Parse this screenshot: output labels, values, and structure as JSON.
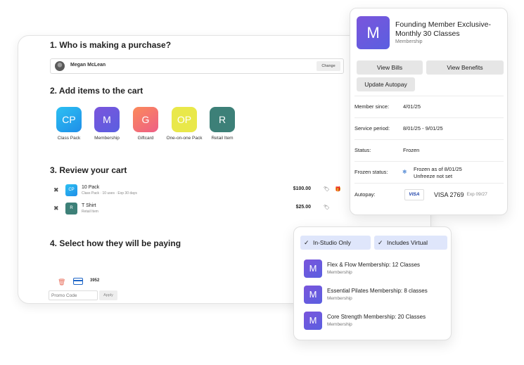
{
  "purchase": {
    "step1_title": "1. Who is making a purchase?",
    "buyer_name": "Megan McLean",
    "change_label": "Change",
    "step2_title": "2. Add items to the cart",
    "add_items": [
      {
        "abbr": "CP",
        "label": "Class Pack",
        "color": "#29a7ee"
      },
      {
        "abbr": "M",
        "label": "Membership",
        "color": "#6b5ae0"
      },
      {
        "abbr": "G",
        "label": "Giftcard",
        "color": "#f57a6e"
      },
      {
        "abbr": "OP",
        "label": "One-on-one Pack",
        "color": "#e9e84a"
      },
      {
        "abbr": "R",
        "label": "Retail Item",
        "color": "#3d8078"
      }
    ],
    "step3_title": "3. Review your cart",
    "cart_items": [
      {
        "abbr": "CP",
        "name": "10 Pack",
        "sub": "Class Pack · 10 uses · Exp 30 days",
        "price": "$100.00",
        "color": "#29a7ee"
      },
      {
        "abbr": "R",
        "name": "T Shirt",
        "sub": "Retail Item",
        "price": "$25.00",
        "color": "#3d8078"
      }
    ],
    "step4_title": "4. Select how they will be paying",
    "card_last4": "3952",
    "promo_placeholder": "Promo Code",
    "apply_label": "Apply"
  },
  "membership_card": {
    "tile_letter": "M",
    "title": "Founding Member Exclusive- Monthly 30 Classes",
    "subtitle": "Membership",
    "buttons": {
      "view_bills": "View Bills",
      "view_benefits": "View Benefits",
      "update_autopay": "Update Autopay"
    },
    "rows": {
      "member_since_label": "Member since:",
      "member_since_value": "4/01/25",
      "service_period_label": "Service period:",
      "service_period_value": "8/01/25 - 9/01/25",
      "status_label": "Status:",
      "status_value": "Frozen",
      "frozen_status_label": "Frozen status:",
      "frozen_line1": "Frozen as of 8/01/25",
      "frozen_line2": "Unfreeze not set",
      "autopay_label": "Autopay:",
      "visa_logo": "VISA",
      "visa_number": "VISA 2769",
      "visa_exp": "Exp 09/27"
    }
  },
  "filter_card": {
    "chips": [
      "In-Studio Only",
      "Includes Virtual"
    ],
    "plans": [
      {
        "letter": "M",
        "name": "Flex & Flow Membership: 12 Classes",
        "sub": "Membership"
      },
      {
        "letter": "M",
        "name": "Essential Pilates Membership: 8 classes",
        "sub": "Membership"
      },
      {
        "letter": "M",
        "name": "Core Strength Membership: 20 Classes",
        "sub": "Membership"
      }
    ]
  }
}
